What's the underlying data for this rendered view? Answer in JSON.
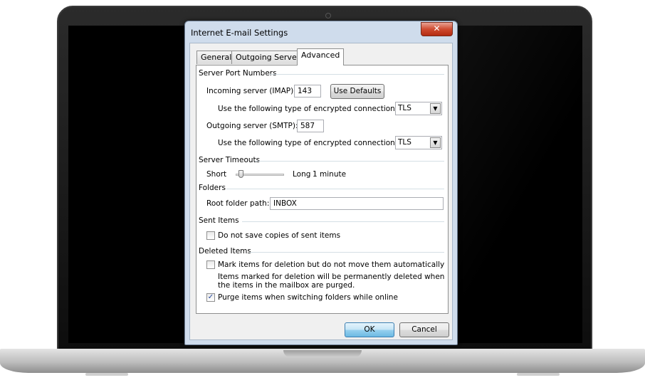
{
  "dialog": {
    "title": "Internet E-mail Settings",
    "close_glyph": "✕",
    "tabs": [
      {
        "label": "General",
        "active": false
      },
      {
        "label": "Outgoing Server",
        "active": false
      },
      {
        "label": "Advanced",
        "active": true
      }
    ]
  },
  "ports": {
    "group_label": "Server Port Numbers",
    "incoming_label": "Incoming server (IMAP):",
    "incoming_value": "143",
    "use_defaults_label": "Use Defaults",
    "incoming_encryption_label": "Use the following type of encrypted connection:",
    "incoming_encryption_value": "TLS",
    "outgoing_label": "Outgoing server (SMTP):",
    "outgoing_value": "587",
    "outgoing_encryption_label": "Use the following type of encrypted connection:",
    "outgoing_encryption_value": "TLS"
  },
  "timeouts": {
    "group_label": "Server Timeouts",
    "short_label": "Short",
    "long_label": "Long",
    "value_label": "1 minute"
  },
  "folders": {
    "group_label": "Folders",
    "root_label": "Root folder path:",
    "root_value": "INBOX"
  },
  "sent_items": {
    "group_label": "Sent Items",
    "do_not_save_label": "Do not save copies of sent items",
    "do_not_save_checked": false
  },
  "deleted_items": {
    "group_label": "Deleted Items",
    "mark_label": "Mark items for deletion but do not move them automatically",
    "mark_checked": false,
    "note_line1": "Items marked for deletion will be permanently deleted when",
    "note_line2": "the items in the mailbox are purged.",
    "purge_label": "Purge items when switching folders while online",
    "purge_checked": true
  },
  "buttons": {
    "ok_label": "OK",
    "cancel_label": "Cancel"
  },
  "icons": {
    "dropdown_arrow": "▼",
    "checkmark": "✓"
  }
}
